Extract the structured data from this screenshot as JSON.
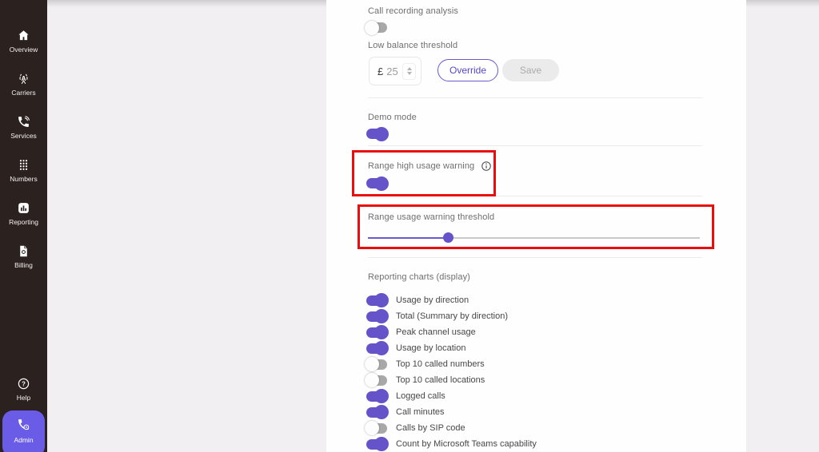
{
  "sidebar": {
    "items": [
      {
        "id": "overview",
        "label": "Overview",
        "icon": "home-icon"
      },
      {
        "id": "carriers",
        "label": "Carriers",
        "icon": "antenna-icon"
      },
      {
        "id": "services",
        "label": "Services",
        "icon": "phone-icon"
      },
      {
        "id": "numbers",
        "label": "Numbers",
        "icon": "dialpad-icon"
      },
      {
        "id": "reporting",
        "label": "Reporting",
        "icon": "bar-chart-icon"
      },
      {
        "id": "billing",
        "label": "Billing",
        "icon": "invoice-icon"
      }
    ],
    "help_label": "Help",
    "admin_label": "Admin"
  },
  "panel": {
    "call_recording_label": "Call recording analysis",
    "call_recording_enabled": false,
    "low_balance_label": "Low balance threshold",
    "currency_symbol": "£",
    "low_balance_value": "25",
    "override_label": "Override",
    "save_label": "Save",
    "demo_mode_label": "Demo mode",
    "demo_mode_enabled": true,
    "range_warning_label": "Range high usage warning",
    "range_warning_enabled": true,
    "range_threshold_label": "Range usage warning threshold",
    "range_threshold_percent": 24.3,
    "reporting_charts_label": "Reporting charts (display)",
    "chart_toggles": [
      {
        "label": "Usage by direction",
        "enabled": true
      },
      {
        "label": "Total (Summary by direction)",
        "enabled": true
      },
      {
        "label": "Peak channel usage",
        "enabled": true
      },
      {
        "label": "Usage by location",
        "enabled": true
      },
      {
        "label": "Top 10 called numbers",
        "enabled": false
      },
      {
        "label": "Top 10 called locations",
        "enabled": false
      },
      {
        "label": "Logged calls",
        "enabled": true
      },
      {
        "label": "Call minutes",
        "enabled": true
      },
      {
        "label": "Calls by SIP code",
        "enabled": false
      },
      {
        "label": "Count by Microsoft Teams capability",
        "enabled": true
      }
    ]
  },
  "colors": {
    "toggle_accent": "#6553c9",
    "override_accent": "#5646c5",
    "admin_accent": "#6b5ce7",
    "sidebar_bg": "#2b211f",
    "annotation_red": "#ea0d0d"
  }
}
